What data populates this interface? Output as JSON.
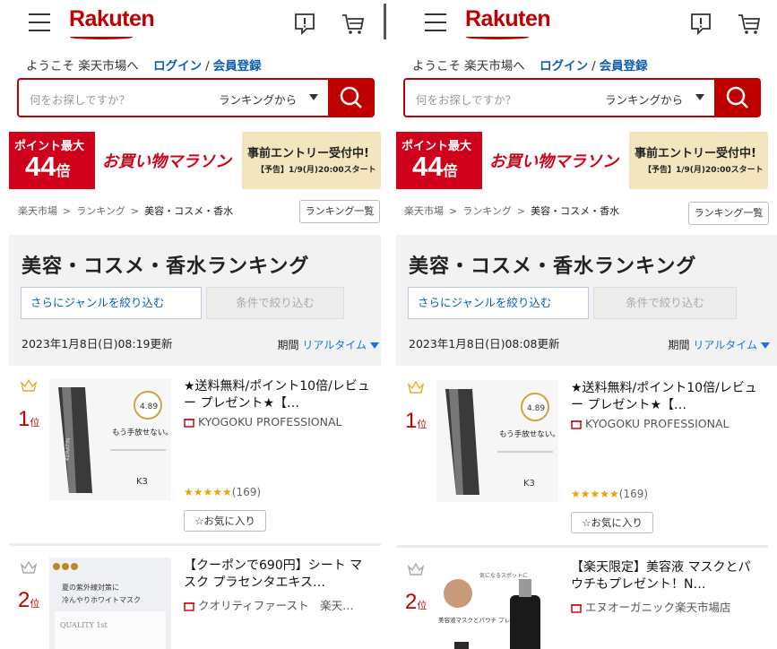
{
  "header": {
    "logo": "Rakuten"
  },
  "welcome": {
    "text": "ようこそ 楽天市場へ",
    "login": "ログイン",
    "slash": "/",
    "register": "会員登録"
  },
  "search": {
    "placeholder": "何をお探しですか？",
    "select": "ランキングから"
  },
  "banner": {
    "left_line1": "ポイント最大",
    "left_big": "44",
    "left_unit": "倍",
    "title": "お買い物マラソン",
    "right_line1": "事前エントリー受付中!",
    "right_line2": "【予告】1/9(月)20:00スタート"
  },
  "breadcrumb": {
    "items": [
      "楽天市場",
      "ランキング",
      "美容・コスメ・香水"
    ],
    "sep": ">"
  },
  "rank_list_button": "ランキング一覧",
  "genre": {
    "title": "美容・コスメ・香水ランキング",
    "narrow_genre": "さらにジャンルを絞り込む",
    "narrow_cond": "条件で絞り込む",
    "period_label": "期間",
    "period_value": "リアルタイム"
  },
  "panels": [
    {
      "updated": "2023年1月8日(日)08:19更新",
      "items": [
        {
          "rank": "1",
          "rank_unit": "位",
          "title": "★送料無料/ポイント10倍/レビュー プレゼント★【…",
          "shop": "KYOGOKU PROFESSIONAL",
          "stars": "★★★★★",
          "reviews": "(169)",
          "fav": "お気に入り",
          "thumb_text": "もう手放せない。",
          "thumb_rating": "4.89"
        },
        {
          "rank": "2",
          "rank_unit": "位",
          "title": "【クーポンで690円】シート マスク プラセンタエキス…",
          "shop": "クオリティファースト　楽天…",
          "thumb_text": "夏の紫外線対策に 冷んやりホワイトマスク",
          "thumb_brand": "QUALITY 1st"
        }
      ]
    },
    {
      "updated": "2023年1月8日(日)08:08更新",
      "items": [
        {
          "rank": "1",
          "rank_unit": "位",
          "title": "★送料無料/ポイント10倍/レビュー プレゼント★【…",
          "shop": "KYOGOKU PROFESSIONAL",
          "stars": "★★★★★",
          "reviews": "(169)",
          "fav": "お気に入り",
          "thumb_text": "もう手放せない。",
          "thumb_rating": "4.89"
        },
        {
          "rank": "2",
          "rank_unit": "位",
          "title": "【楽天限定】美容液 マスクとパウチもプレゼント！N…",
          "shop": "エヌオーガニック楽天市場店",
          "thumb_text": "美容液マスクとパウチ プレゼント"
        }
      ]
    }
  ],
  "colors": {
    "brand": "#bf0000",
    "link": "#0a5fb4",
    "star": "#f0a000"
  }
}
